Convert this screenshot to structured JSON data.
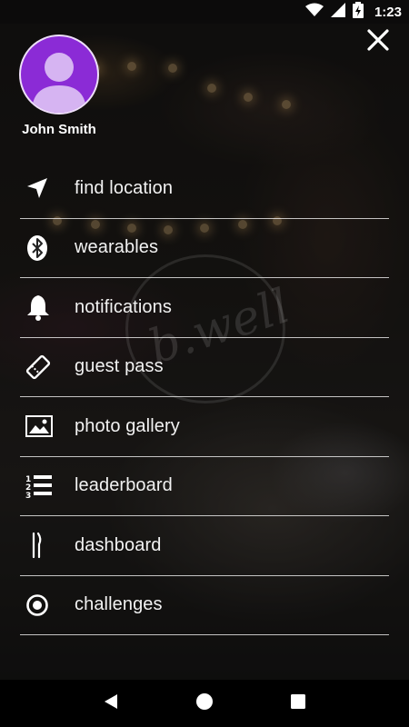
{
  "status_bar": {
    "time": "1:23",
    "icons": [
      "wifi-icon",
      "signal-icon",
      "battery-icon"
    ]
  },
  "header": {
    "close_icon": "close-icon"
  },
  "profile": {
    "name": "John Smith",
    "avatar_icon": "avatar-icon",
    "avatar_color": "#8b2bd6"
  },
  "menu": {
    "items": [
      {
        "label": "find location",
        "icon": "navigation-arrow-icon"
      },
      {
        "label": "wearables",
        "icon": "bluetooth-icon"
      },
      {
        "label": "notifications",
        "icon": "bell-icon"
      },
      {
        "label": "guest pass",
        "icon": "ticket-icon"
      },
      {
        "label": "photo gallery",
        "icon": "image-icon"
      },
      {
        "label": "leaderboard",
        "icon": "numbered-list-icon"
      },
      {
        "label": "dashboard",
        "icon": "fork-knife-icon"
      },
      {
        "label": "challenges",
        "icon": "target-icon"
      }
    ]
  },
  "nav_bar": {
    "buttons": [
      "back-icon",
      "home-icon",
      "recents-icon"
    ]
  }
}
